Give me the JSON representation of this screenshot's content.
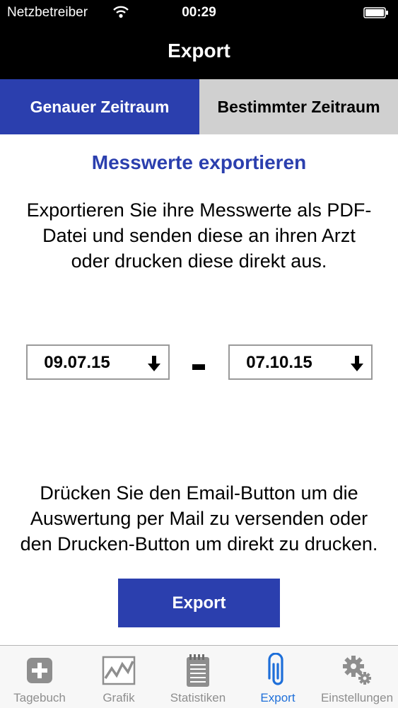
{
  "status_bar": {
    "carrier": "Netzbetreiber",
    "time": "00:29"
  },
  "navbar": {
    "title": "Export"
  },
  "segments": {
    "exact": "Genauer Zeitraum",
    "specific": "Bestimmter Zeitraum",
    "selected": "exact"
  },
  "content": {
    "heading": "Messwerte exportieren",
    "intro": "Exportieren Sie ihre Messwerte als PDF-Datei und senden diese an ihren Arzt oder drucken diese direkt aus.",
    "date_from": "09.07.15",
    "date_to": "07.10.15",
    "hint": "Drücken Sie den Email-Button um die Auswertung per Mail zu versenden oder den Drucken-Button um direkt zu drucken.",
    "export_button": "Export"
  },
  "tabs": [
    {
      "label": "Tagebuch",
      "icon": "plus-square-icon"
    },
    {
      "label": "Grafik",
      "icon": "line-chart-icon"
    },
    {
      "label": "Statistiken",
      "icon": "notepad-icon"
    },
    {
      "label": "Export",
      "icon": "paperclip-icon",
      "selected": true
    },
    {
      "label": "Einstellungen",
      "icon": "gears-icon"
    }
  ],
  "colors": {
    "accent": "#2b3fae",
    "tab_selected": "#1e6fd9",
    "segment_inactive": "#d0d0d0"
  }
}
